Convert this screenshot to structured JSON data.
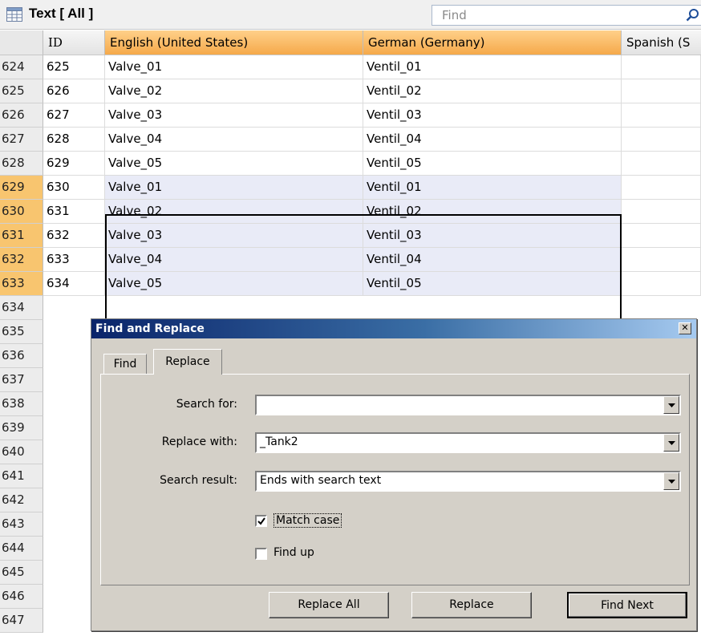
{
  "header": {
    "title": "Text [ All ]",
    "find_placeholder": "Find"
  },
  "grid": {
    "columns": [
      {
        "label": "ID"
      },
      {
        "label": "English (United States)"
      },
      {
        "label": "German (Germany)"
      },
      {
        "label": "Spanish (S"
      }
    ],
    "rows": [
      {
        "num": "624",
        "id": "625",
        "en": "Valve_01",
        "de": "Ventil_01"
      },
      {
        "num": "625",
        "id": "626",
        "en": "Valve_02",
        "de": "Ventil_02"
      },
      {
        "num": "626",
        "id": "627",
        "en": "Valve_03",
        "de": "Ventil_03"
      },
      {
        "num": "627",
        "id": "628",
        "en": "Valve_04",
        "de": "Ventil_04"
      },
      {
        "num": "628",
        "id": "629",
        "en": "Valve_05",
        "de": "Ventil_05"
      },
      {
        "num": "629",
        "id": "630",
        "en": "Valve_01",
        "de": "Ventil_01"
      },
      {
        "num": "630",
        "id": "631",
        "en": "Valve_02",
        "de": "Ventil_02"
      },
      {
        "num": "631",
        "id": "632",
        "en": "Valve_03",
        "de": "Ventil_03"
      },
      {
        "num": "632",
        "id": "633",
        "en": "Valve_04",
        "de": "Ventil_04"
      },
      {
        "num": "633",
        "id": "634",
        "en": "Valve_05",
        "de": "Ventil_05"
      }
    ],
    "empty_row_numbers": [
      "634",
      "635",
      "636",
      "637",
      "638",
      "639",
      "640",
      "641",
      "642",
      "643",
      "644",
      "645",
      "646",
      "647"
    ]
  },
  "dialog": {
    "title": "Find and Replace",
    "tabs": {
      "find": "Find",
      "replace": "Replace"
    },
    "active_tab": "Replace",
    "search_for": {
      "label": "Search for:",
      "value": ""
    },
    "replace_with": {
      "label": "Replace with:",
      "value": "_Tank2"
    },
    "search_result": {
      "label": "Search result:",
      "value": "Ends with search text"
    },
    "match_case": {
      "label": "Match case",
      "checked": true
    },
    "find_up": {
      "label": "Find up",
      "checked": false
    },
    "buttons": {
      "replace_all": "Replace All",
      "replace": "Replace",
      "find_next": "Find Next"
    }
  },
  "colors": {
    "selected_header": "#f5a94a",
    "selected_row_number": "#f8c56f",
    "selected_cell": "#e9ebf7",
    "dialog_face": "#d4d0c8",
    "title_bar": "#0a246a"
  }
}
